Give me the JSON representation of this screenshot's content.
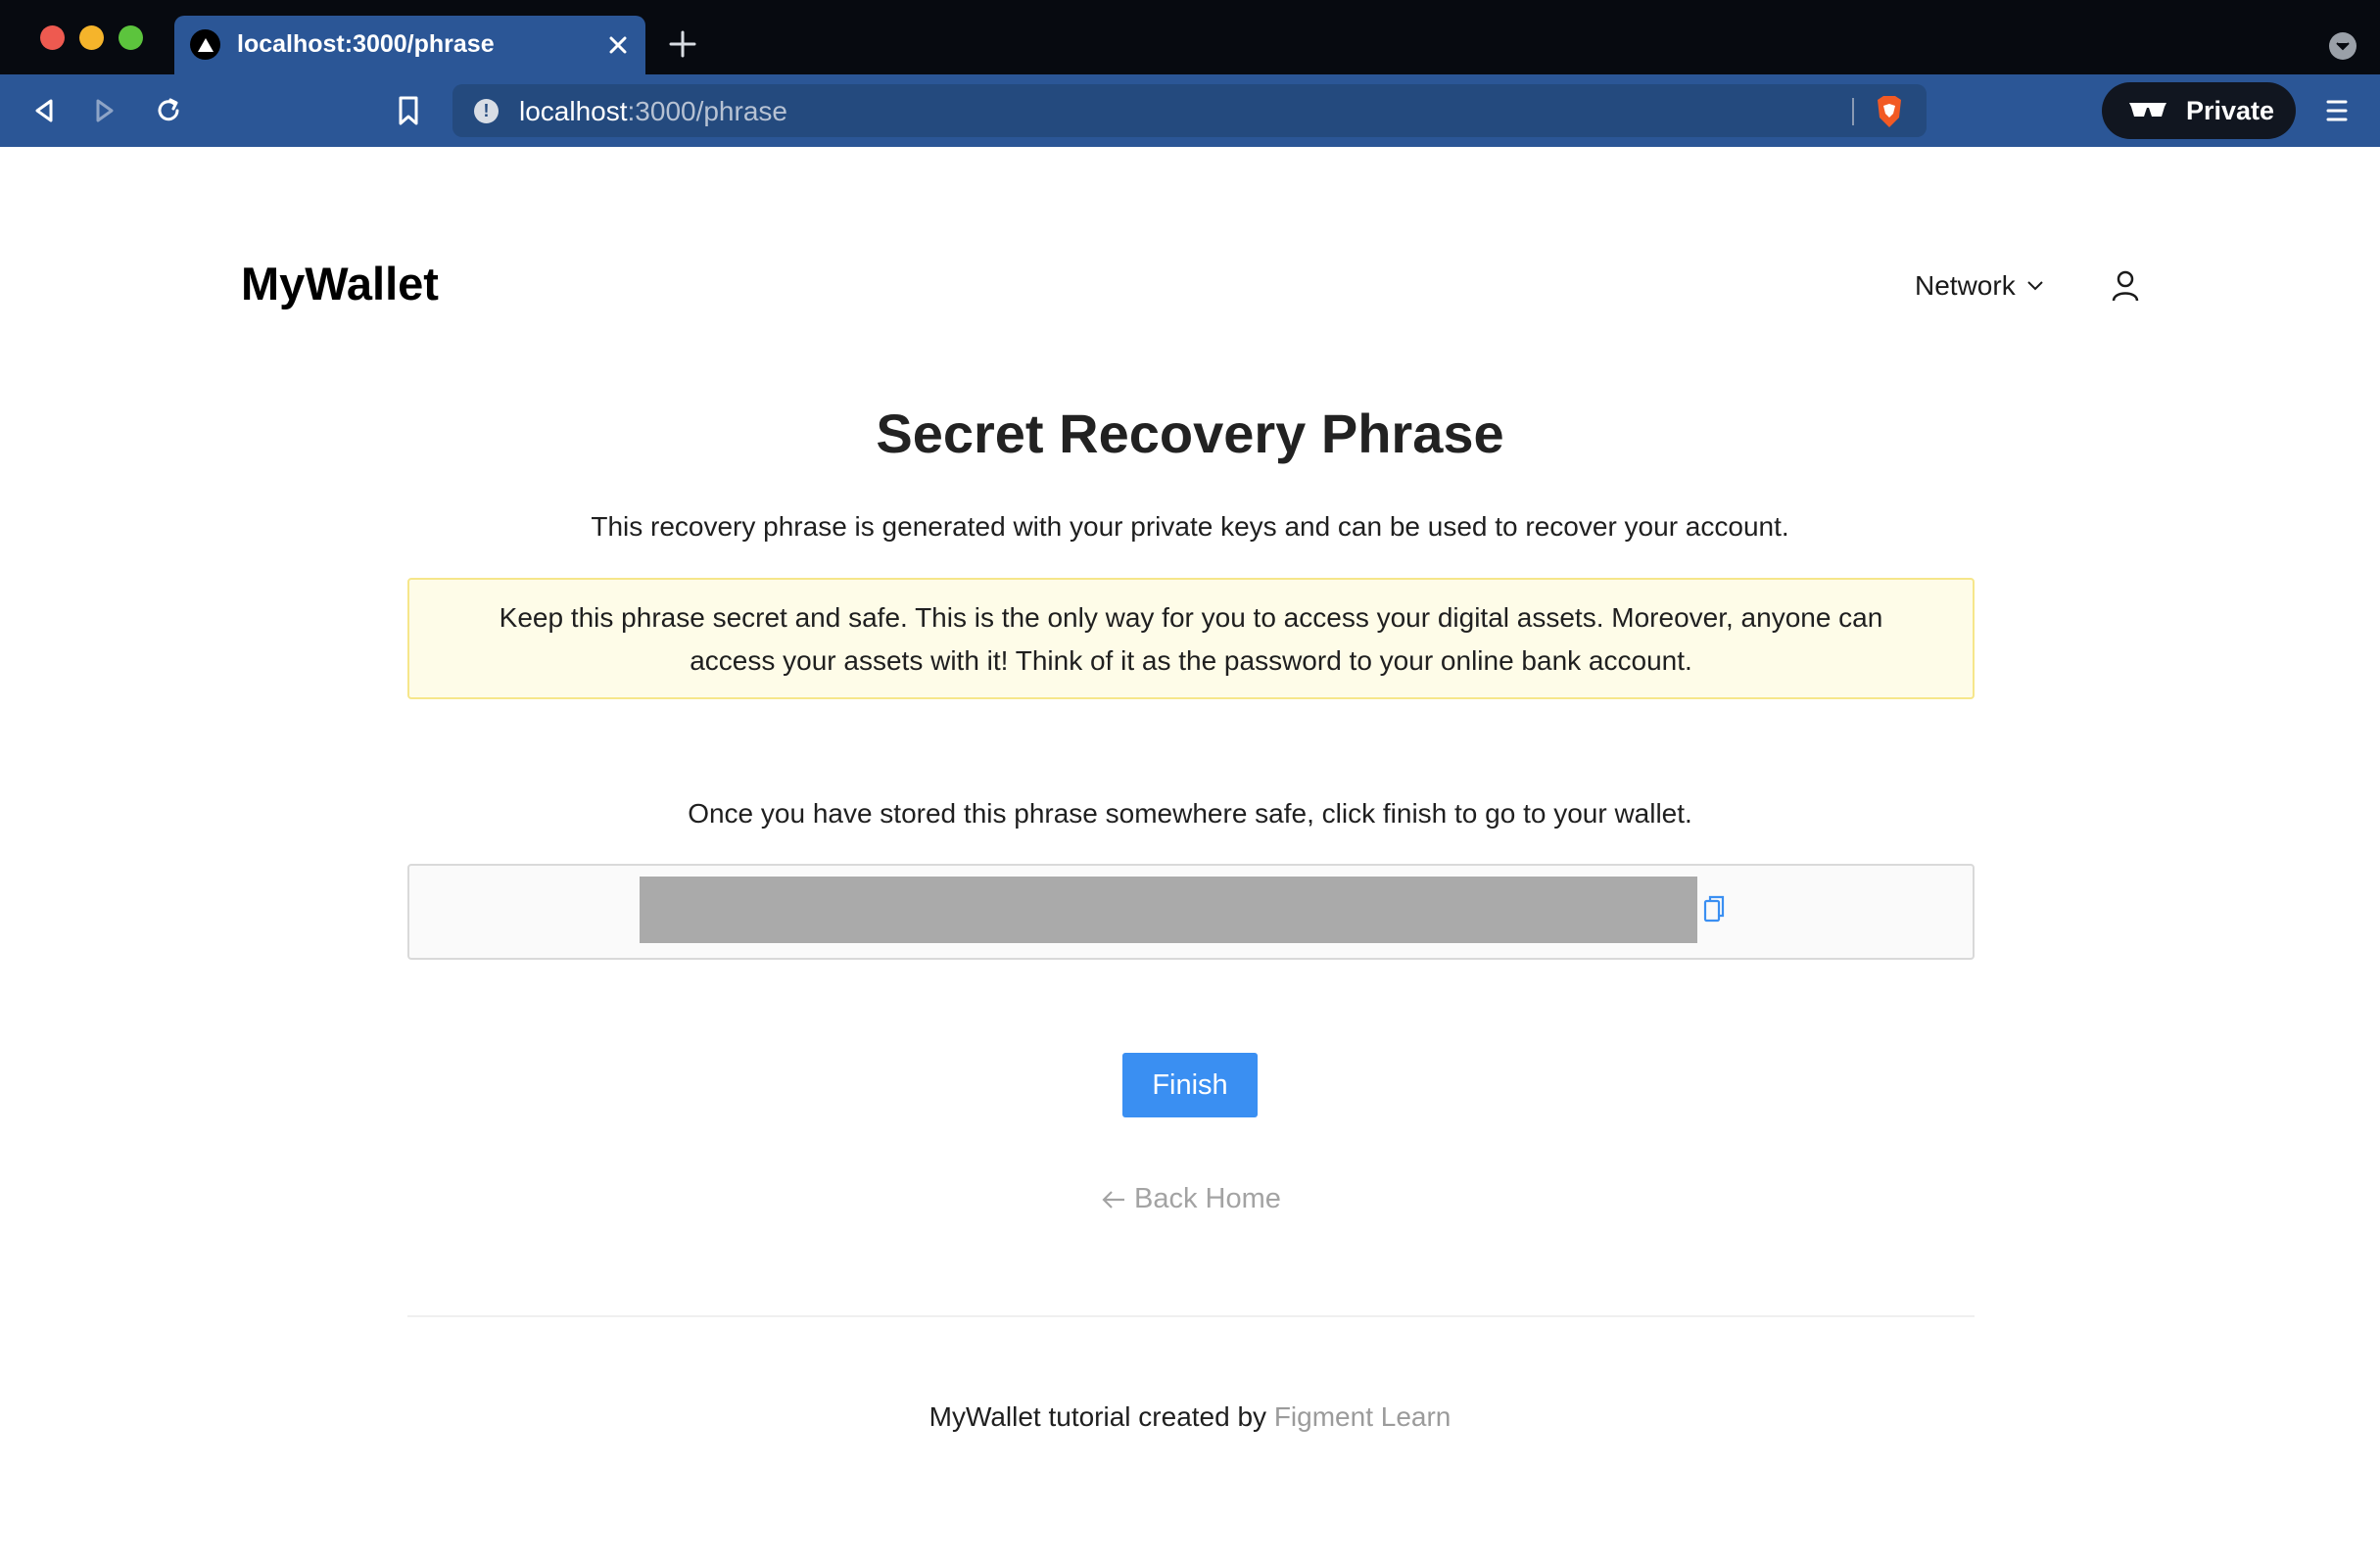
{
  "browser": {
    "tab_title": "localhost:3000/phrase",
    "url_host": "localhost",
    "url_path": ":3000/phrase",
    "private_label": "Private",
    "icons": [
      "back-icon",
      "forward-icon",
      "reload-icon",
      "bookmark-icon",
      "info-icon",
      "brave-shield-icon",
      "private-glasses-icon",
      "menu-icon"
    ]
  },
  "header": {
    "brand": "MyWallet",
    "network_label": "Network"
  },
  "main": {
    "title": "Secret Recovery Phrase",
    "intro": "This recovery phrase is generated with your private keys and can be used to recover your account.",
    "warning_line1": "Keep this phrase secret and safe. This is the only way for you to access your digital assets. Moreover, anyone can",
    "warning_line2": "access your assets with it! Think of it as the password to your online bank account.",
    "stored_text": "Once you have stored this phrase somewhere safe, click finish to go to your wallet.",
    "finish_label": "Finish",
    "back_label": "Back Home"
  },
  "footer": {
    "text": "MyWallet tutorial created by",
    "link": "Figment Learn"
  },
  "colors": {
    "chrome_bg": "#070a10",
    "toolbar_bg": "#2b5696",
    "primary": "#3a8ff2",
    "warning_bg": "#fefce8",
    "warning_border": "#f6e68a",
    "muted": "#a3a3a3"
  }
}
